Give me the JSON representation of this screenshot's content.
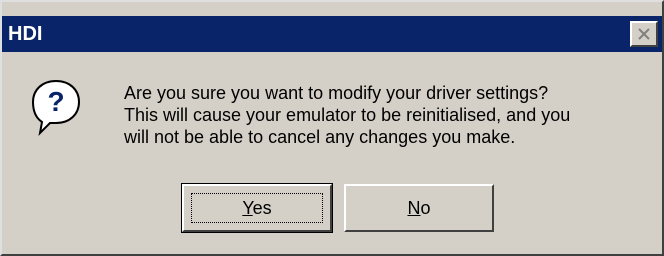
{
  "window": {
    "title": "HDI"
  },
  "dialog": {
    "icon": "question-icon",
    "message_lines": [
      "Are you sure you want to modify your driver settings?",
      "This will cause your emulator to be reinitialised, and you",
      "will not be able to cancel any changes you make."
    ]
  },
  "buttons": {
    "yes": {
      "mnemonic": "Y",
      "rest": "es"
    },
    "no": {
      "mnemonic": "N",
      "rest": "o"
    }
  },
  "colors": {
    "titlebar": "#0a246a",
    "face": "#d4d0c8",
    "icon_fill": "#0a246a"
  }
}
